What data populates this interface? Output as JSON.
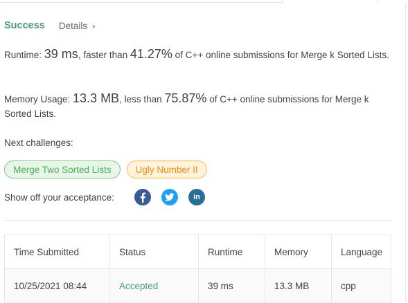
{
  "result": {
    "status": "Success",
    "details_label": "Details",
    "details_chevron": "›"
  },
  "runtime": {
    "label": "Runtime: ",
    "value": "39 ms",
    "mid": ", faster than ",
    "percent": "41.27%",
    "suffix": " of C++ online submissions for Merge k Sorted Lists."
  },
  "memory": {
    "label": "Memory Usage: ",
    "value": "13.3 MB",
    "mid": ", less than ",
    "percent": "75.87%",
    "suffix": " of C++ online submissions for Merge k Sorted Lists."
  },
  "next": {
    "label": "Next challenges:",
    "challenges": [
      "Merge Two Sorted Lists",
      "Ugly Number II"
    ]
  },
  "share": {
    "label": "Show off your acceptance:",
    "icons": [
      "facebook-icon",
      "twitter-icon",
      "linkedin-icon"
    ],
    "linkedin_text": "in"
  },
  "table": {
    "headers": [
      "Time Submitted",
      "Status",
      "Runtime",
      "Memory",
      "Language"
    ],
    "rows": [
      [
        "10/25/2021 08:44",
        "Accepted",
        "39 ms",
        "13.3 MB",
        "cpp"
      ]
    ]
  },
  "colors": {
    "success": "#4a9d6e",
    "chip_green": "#4caf50",
    "chip_orange": "#fb8c00",
    "facebook": "#3b5998",
    "twitter": "#1da1f2",
    "linkedin": "#2a6e95"
  }
}
